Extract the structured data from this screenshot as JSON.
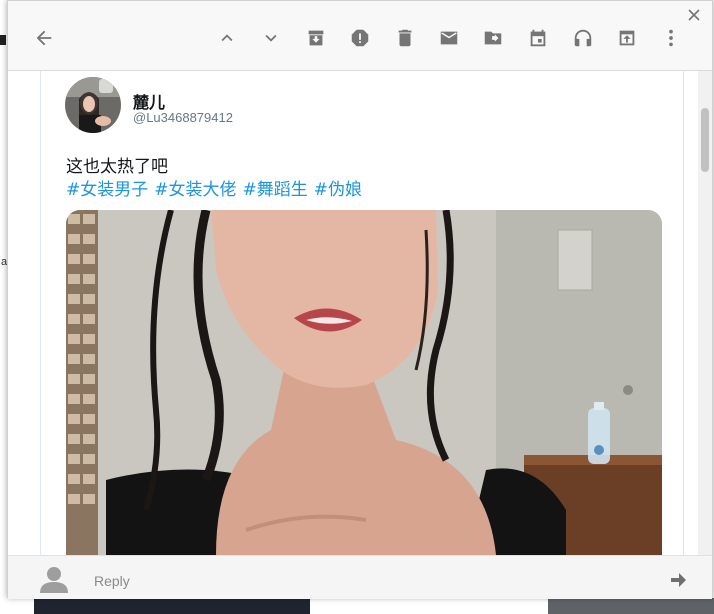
{
  "background": {
    "left_letter": "a"
  },
  "toolbar": {
    "icons": [
      "back-arrow-icon",
      "chevron-up-icon",
      "chevron-down-icon",
      "archive-icon",
      "report-spam-icon",
      "trash-icon",
      "mail-icon",
      "move-to-icon",
      "calendar-icon",
      "headphones-icon",
      "open-in-new-icon",
      "more-vert-icon",
      "close-icon"
    ],
    "icon_color": "#757575"
  },
  "tweet": {
    "display_name": "麓儿",
    "handle": "@Lu3468879412",
    "text": "这也太热了吧",
    "hashtags": [
      "#女装男子",
      "#女装大佬",
      "#舞蹈生",
      "#伪娘"
    ],
    "hashtag_color": "#1b95e0"
  },
  "reply": {
    "label": "Reply"
  }
}
